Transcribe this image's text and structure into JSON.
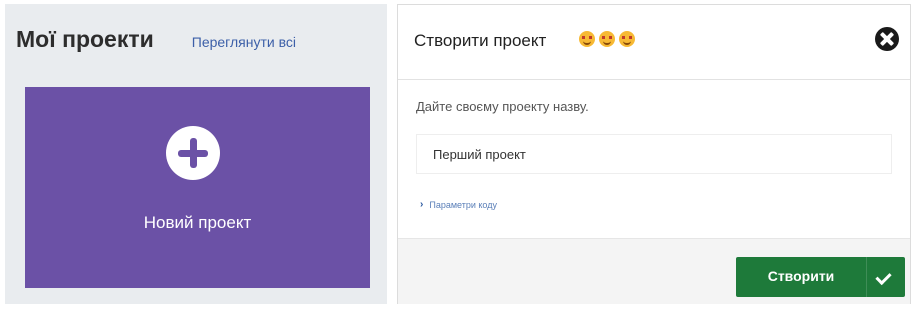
{
  "projects_panel": {
    "title": "Мої проекти",
    "view_all_label": "Переглянути всі",
    "new_project_label": "Новий проект",
    "card_color": "#6b51a6",
    "plus_icon": "plus-circle-icon"
  },
  "dialog": {
    "title": "Створити проект",
    "title_emojis": [
      "smiling-face-icon",
      "smiling-face-icon",
      "smiling-face-icon"
    ],
    "close_icon": "close-circle-icon",
    "prompt": "Дайте своєму проекту назву.",
    "project_name_value": "Перший проект",
    "code_options_label": "Параметри коду",
    "create_button_label": "Створити",
    "create_button_color": "#1e7a3a",
    "check_icon": "check-icon"
  }
}
